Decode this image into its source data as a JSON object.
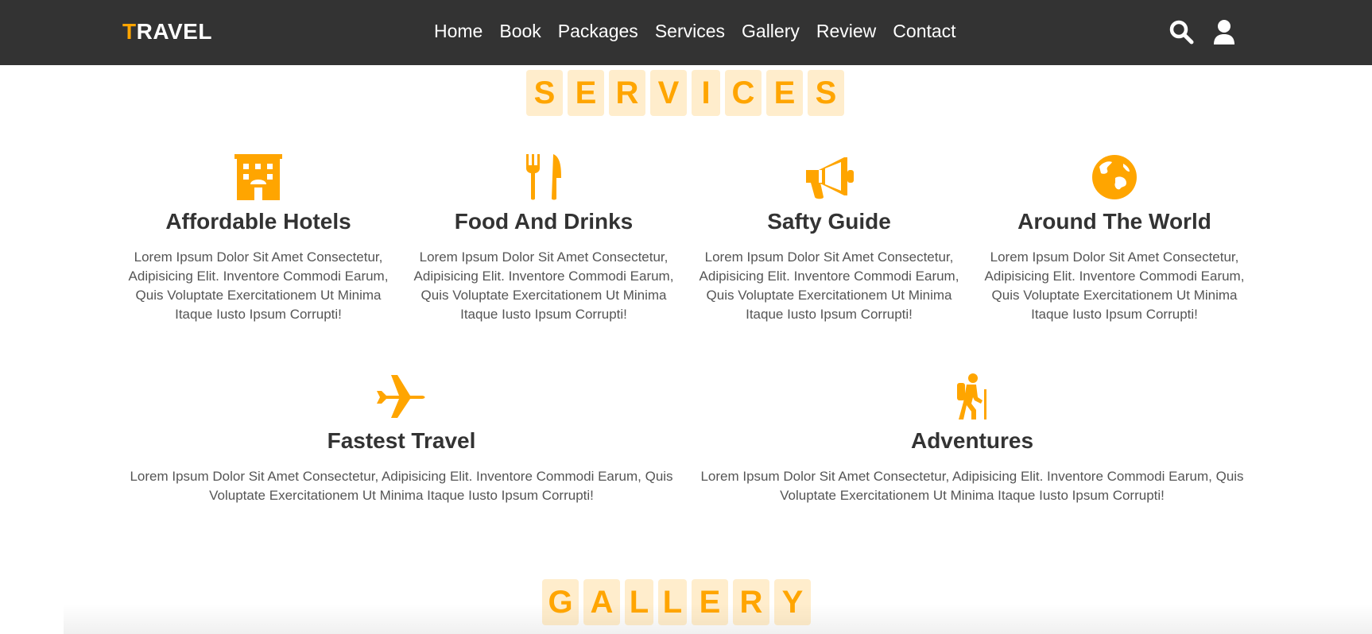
{
  "header": {
    "logo_first": "T",
    "logo_rest": "RAVEL",
    "nav": [
      "Home",
      "Book",
      "Packages",
      "Services",
      "Gallery",
      "Review",
      "Contact"
    ],
    "icons": [
      "search-icon",
      "user-icon"
    ]
  },
  "services": {
    "heading_letters": [
      "S",
      "E",
      "R",
      "V",
      "I",
      "C",
      "E",
      "S"
    ],
    "items": [
      {
        "icon": "hotel-icon",
        "title": "Affordable Hotels",
        "text": "Lorem Ipsum Dolor Sit Amet Consectetur, Adipisicing Elit. Inventore Commodi Earum, Quis Voluptate Exercitationem Ut Minima Itaque Iusto Ipsum Corrupti!"
      },
      {
        "icon": "utensils-icon",
        "title": "Food And Drinks",
        "text": "Lorem Ipsum Dolor Sit Amet Consectetur, Adipisicing Elit. Inventore Commodi Earum, Quis Voluptate Exercitationem Ut Minima Itaque Iusto Ipsum Corrupti!"
      },
      {
        "icon": "bullhorn-icon",
        "title": "Safty Guide",
        "text": "Lorem Ipsum Dolor Sit Amet Consectetur, Adipisicing Elit. Inventore Commodi Earum, Quis Voluptate Exercitationem Ut Minima Itaque Iusto Ipsum Corrupti!"
      },
      {
        "icon": "globe-icon",
        "title": "Around The World",
        "text": "Lorem Ipsum Dolor Sit Amet Consectetur, Adipisicing Elit. Inventore Commodi Earum, Quis Voluptate Exercitationem Ut Minima Itaque Iusto Ipsum Corrupti!"
      },
      {
        "icon": "plane-icon",
        "title": "Fastest Travel",
        "text": "Lorem Ipsum Dolor Sit Amet Consectetur, Adipisicing Elit. Inventore Commodi Earum, Quis Voluptate Exercitationem Ut Minima Itaque Iusto Ipsum Corrupti!"
      },
      {
        "icon": "hiking-icon",
        "title": "Adventures",
        "text": "Lorem Ipsum Dolor Sit Amet Consectetur, Adipisicing Elit. Inventore Commodi Earum, Quis Voluptate Exercitationem Ut Minima Itaque Iusto Ipsum Corrupti!"
      }
    ]
  },
  "gallery": {
    "heading_letters": [
      "G",
      "A",
      "L",
      "L",
      "E",
      "R",
      "Y"
    ]
  },
  "colors": {
    "accent": "#ffa500",
    "header_bg": "#333333",
    "text": "#333333",
    "muted": "#555555"
  }
}
